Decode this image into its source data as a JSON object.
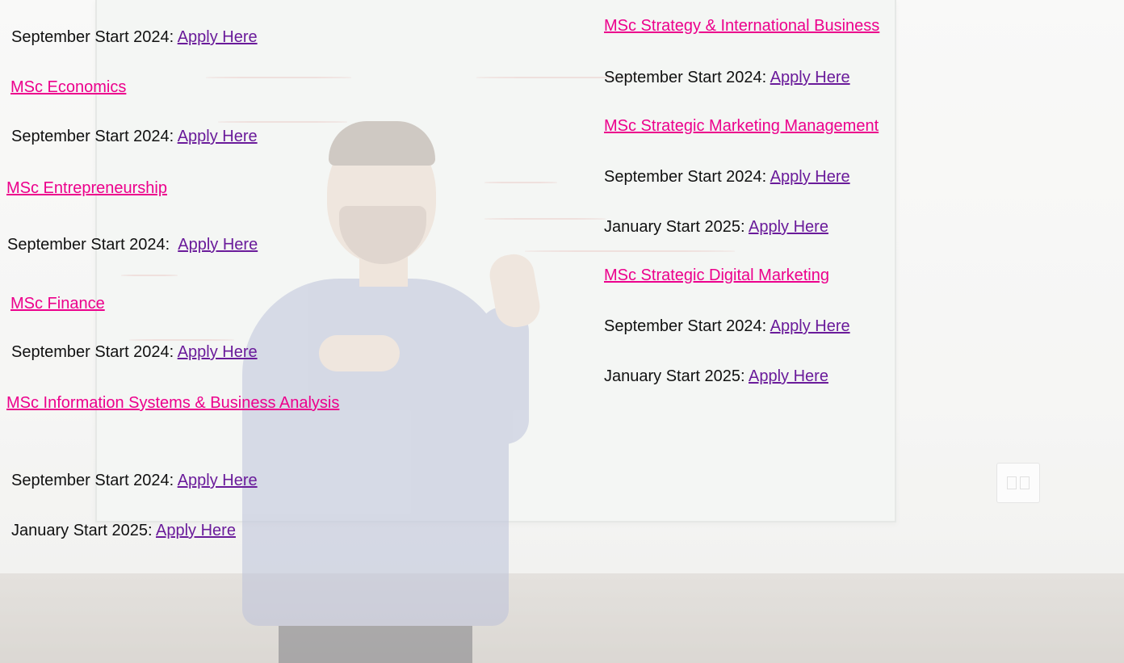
{
  "left_column": [
    {
      "start": "September Start 2024: ",
      "apply": "Apply Here"
    },
    {
      "programme": "MSc Economics"
    },
    {
      "start": "September Start 2024: ",
      "apply": "Apply Here"
    },
    {
      "programme": "MSc Entrepreneurship"
    },
    {
      "start": "September Start 2024:  ",
      "apply": "Apply Here"
    },
    {
      "programme": "MSc Finance"
    },
    {
      "start": "September Start 2024: ",
      "apply": "Apply Here"
    },
    {
      "programme": "MSc Information Systems & Business Analysis"
    },
    {
      "start": "September Start 2024: ",
      "apply": "Apply Here"
    },
    {
      "start": "January Start 2025: ",
      "apply": "Apply Here"
    }
  ],
  "right_column": [
    {
      "programme": "MSc Strategy & International Business"
    },
    {
      "start": "September Start 2024: ",
      "apply": "Apply Here"
    },
    {
      "programme": "MSc Strategic Marketing Management"
    },
    {
      "start": "September Start 2024: ",
      "apply": "Apply Here"
    },
    {
      "start": "January Start 2025: ",
      "apply": "Apply Here"
    },
    {
      "programme": "MSc Strategic Digital Marketing"
    },
    {
      "start": "September Start 2024: ",
      "apply": "Apply Here"
    },
    {
      "start": "January Start 2025: ",
      "apply": "Apply Here"
    }
  ],
  "colors": {
    "programme_link": "#ec008c",
    "apply_link": "#6a1b9a",
    "body_text": "#111111"
  }
}
